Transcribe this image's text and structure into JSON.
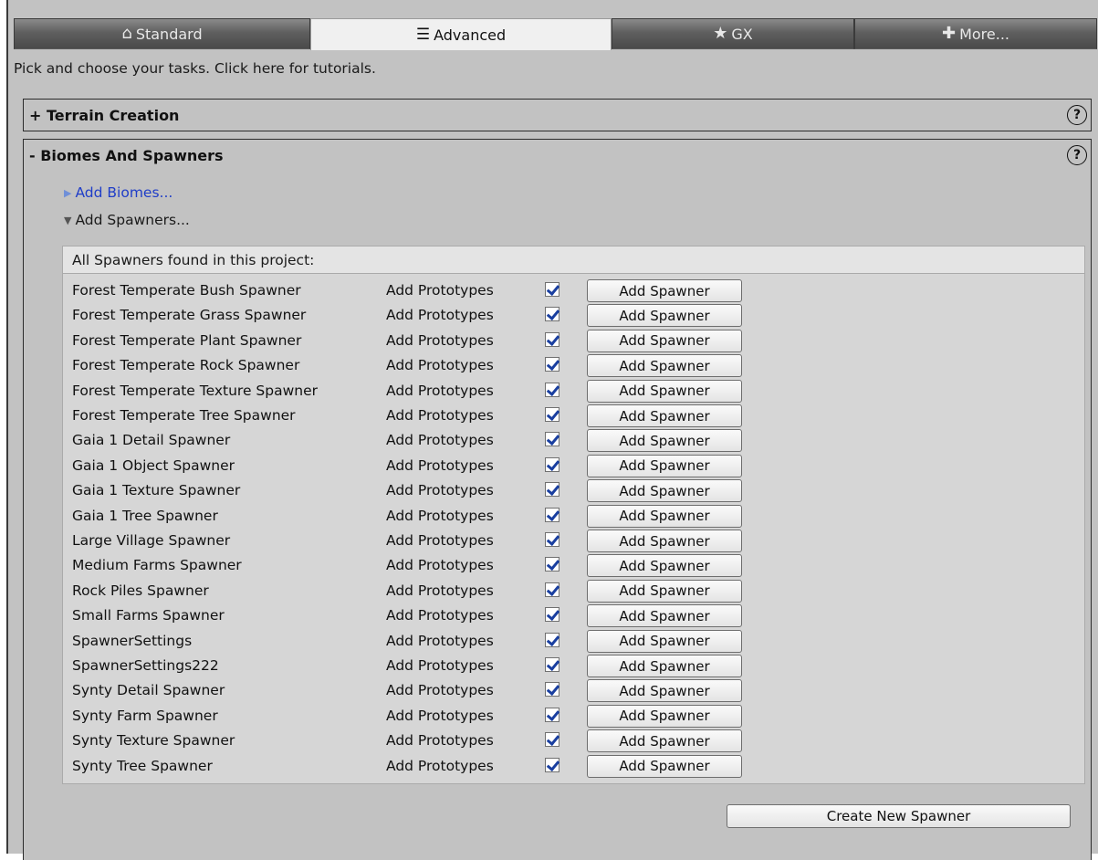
{
  "tabs": [
    {
      "label": "Standard",
      "icon": "house-icon",
      "glyph": "⌂",
      "active": false
    },
    {
      "label": "Advanced",
      "icon": "list-icon",
      "glyph": "☰",
      "active": true
    },
    {
      "label": "GX",
      "icon": "star-icon",
      "glyph": "★",
      "active": false
    },
    {
      "label": "More...",
      "icon": "plus-icon",
      "glyph": "✚",
      "active": false
    }
  ],
  "intro": "Pick and choose your tasks. Click here for tutorials.",
  "sections": {
    "terrain": {
      "toggle": "+",
      "title": "Terrain Creation",
      "help": "?"
    },
    "biomes": {
      "toggle": "-",
      "title": "Biomes And Spawners",
      "help": "?"
    }
  },
  "foldouts": {
    "biomes": {
      "arrow": "▶",
      "label": "Add Biomes..."
    },
    "spawners": {
      "arrow": "▼",
      "label": "Add Spawners..."
    }
  },
  "spawner_panel": {
    "title": "All Spawners found in this project:",
    "proto_label": "Add Prototypes",
    "add_label": "Add Spawner",
    "rows": [
      {
        "name": "Forest Temperate Bush Spawner",
        "checked": true
      },
      {
        "name": "Forest Temperate Grass Spawner",
        "checked": true
      },
      {
        "name": "Forest Temperate Plant Spawner",
        "checked": true
      },
      {
        "name": "Forest Temperate Rock Spawner",
        "checked": true
      },
      {
        "name": "Forest Temperate Texture Spawner",
        "checked": true
      },
      {
        "name": "Forest Temperate Tree Spawner",
        "checked": true
      },
      {
        "name": "Gaia 1 Detail Spawner",
        "checked": true
      },
      {
        "name": "Gaia 1 Object Spawner",
        "checked": true
      },
      {
        "name": "Gaia 1 Texture Spawner",
        "checked": true
      },
      {
        "name": "Gaia 1 Tree Spawner",
        "checked": true
      },
      {
        "name": "Large Village Spawner",
        "checked": true
      },
      {
        "name": "Medium Farms Spawner",
        "checked": true
      },
      {
        "name": "Rock Piles Spawner",
        "checked": true
      },
      {
        "name": "Small Farms Spawner",
        "checked": true
      },
      {
        "name": "SpawnerSettings",
        "checked": true
      },
      {
        "name": "SpawnerSettings222",
        "checked": true
      },
      {
        "name": "Synty Detail Spawner",
        "checked": true
      },
      {
        "name": "Synty Farm Spawner",
        "checked": true
      },
      {
        "name": "Synty Texture Spawner",
        "checked": true
      },
      {
        "name": "Synty Tree Spawner",
        "checked": true
      }
    ]
  },
  "create_button": "Create New Spawner"
}
